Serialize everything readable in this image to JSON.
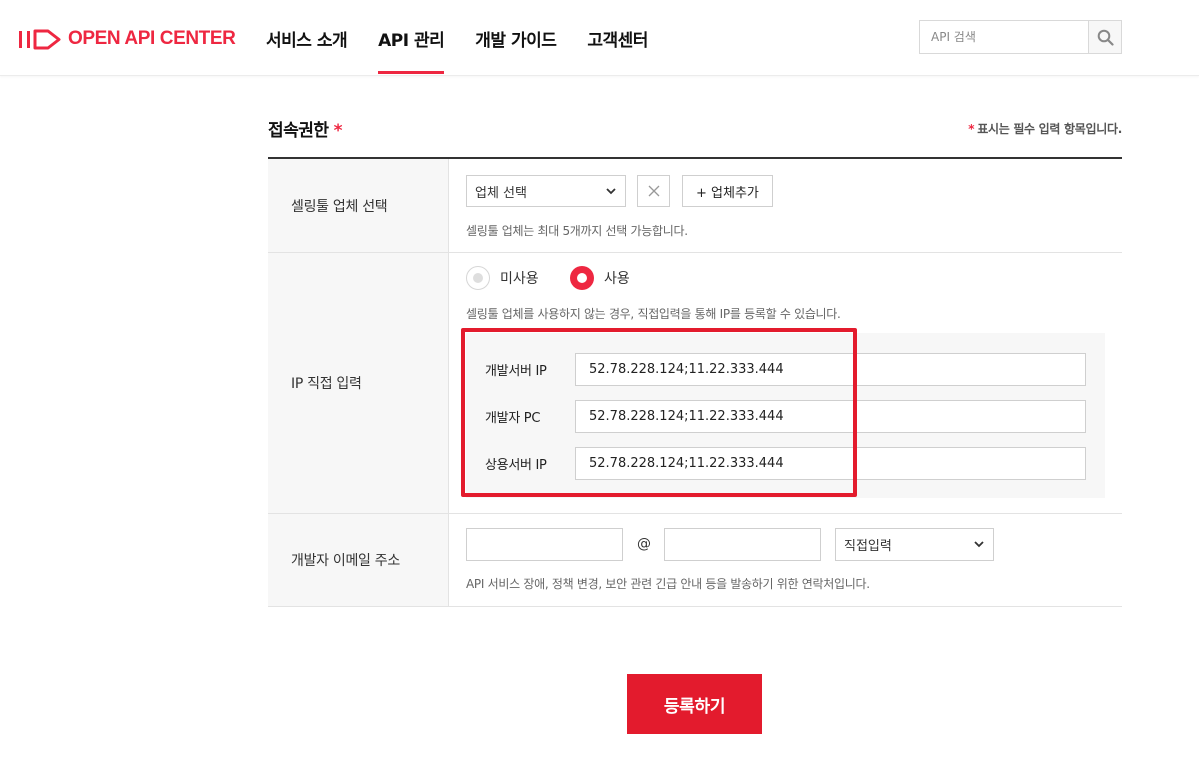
{
  "header": {
    "logo_text": "OPEN API CENTER",
    "nav": [
      "서비스 소개",
      "API 관리",
      "개발 가이드",
      "고객센터"
    ],
    "active_nav": "API 관리",
    "search_placeholder": "API 검색"
  },
  "section": {
    "title": "접속권한",
    "required_mark": "*",
    "required_note_star": "*",
    "required_note": "표시는 필수 입력 항목입니다."
  },
  "selling_tool": {
    "label": "셀링툴 업체 선택",
    "select_value": "업체 선택",
    "add_button": "+ 업체추가",
    "help": "셀링툴 업체는 최대 5개까지 선택 가능합니다."
  },
  "ip_input": {
    "label": "IP 직접 입력",
    "radio_unused": "미사용",
    "radio_used": "사용",
    "selected": "사용",
    "help": "셀링툴 업체를 사용하지 않는 경우, 직접입력을 통해 IP를 등록할 수 있습니다.",
    "fields": [
      {
        "label": "개발서버 IP",
        "value": "52.78.228.124;11.22.333.444"
      },
      {
        "label": "개발자 PC",
        "value": "52.78.228.124;11.22.333.444"
      },
      {
        "label": "상용서버 IP",
        "value": "52.78.228.124;11.22.333.444"
      }
    ]
  },
  "email": {
    "label": "개발자 이메일 주소",
    "local_value": "",
    "at": "@",
    "domain_value": "",
    "domain_select": "직접입력",
    "help": "API 서비스 장애, 정책 변경, 보안 관련 긴급 안내 등을 발송하기 위한 연락처입니다."
  },
  "submit_label": "등록하기",
  "colors": {
    "brand": "#ee2741",
    "highlight": "#e31b2d"
  }
}
